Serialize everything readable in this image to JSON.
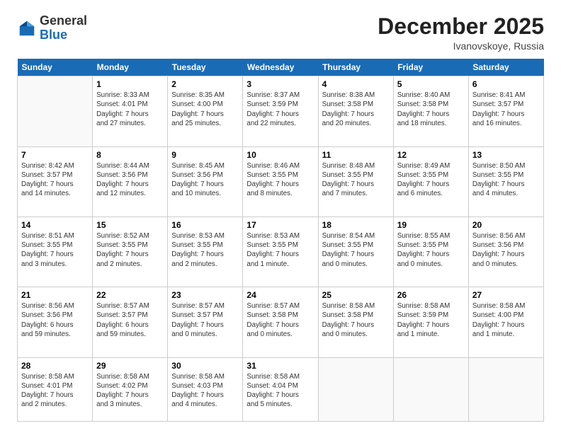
{
  "logo": {
    "general": "General",
    "blue": "Blue"
  },
  "title": "December 2025",
  "location": "Ivanovskoye, Russia",
  "days_header": [
    "Sunday",
    "Monday",
    "Tuesday",
    "Wednesday",
    "Thursday",
    "Friday",
    "Saturday"
  ],
  "weeks": [
    [
      {
        "day": "",
        "info": ""
      },
      {
        "day": "1",
        "info": "Sunrise: 8:33 AM\nSunset: 4:01 PM\nDaylight: 7 hours\nand 27 minutes."
      },
      {
        "day": "2",
        "info": "Sunrise: 8:35 AM\nSunset: 4:00 PM\nDaylight: 7 hours\nand 25 minutes."
      },
      {
        "day": "3",
        "info": "Sunrise: 8:37 AM\nSunset: 3:59 PM\nDaylight: 7 hours\nand 22 minutes."
      },
      {
        "day": "4",
        "info": "Sunrise: 8:38 AM\nSunset: 3:58 PM\nDaylight: 7 hours\nand 20 minutes."
      },
      {
        "day": "5",
        "info": "Sunrise: 8:40 AM\nSunset: 3:58 PM\nDaylight: 7 hours\nand 18 minutes."
      },
      {
        "day": "6",
        "info": "Sunrise: 8:41 AM\nSunset: 3:57 PM\nDaylight: 7 hours\nand 16 minutes."
      }
    ],
    [
      {
        "day": "7",
        "info": "Sunrise: 8:42 AM\nSunset: 3:57 PM\nDaylight: 7 hours\nand 14 minutes."
      },
      {
        "day": "8",
        "info": "Sunrise: 8:44 AM\nSunset: 3:56 PM\nDaylight: 7 hours\nand 12 minutes."
      },
      {
        "day": "9",
        "info": "Sunrise: 8:45 AM\nSunset: 3:56 PM\nDaylight: 7 hours\nand 10 minutes."
      },
      {
        "day": "10",
        "info": "Sunrise: 8:46 AM\nSunset: 3:55 PM\nDaylight: 7 hours\nand 8 minutes."
      },
      {
        "day": "11",
        "info": "Sunrise: 8:48 AM\nSunset: 3:55 PM\nDaylight: 7 hours\nand 7 minutes."
      },
      {
        "day": "12",
        "info": "Sunrise: 8:49 AM\nSunset: 3:55 PM\nDaylight: 7 hours\nand 6 minutes."
      },
      {
        "day": "13",
        "info": "Sunrise: 8:50 AM\nSunset: 3:55 PM\nDaylight: 7 hours\nand 4 minutes."
      }
    ],
    [
      {
        "day": "14",
        "info": "Sunrise: 8:51 AM\nSunset: 3:55 PM\nDaylight: 7 hours\nand 3 minutes."
      },
      {
        "day": "15",
        "info": "Sunrise: 8:52 AM\nSunset: 3:55 PM\nDaylight: 7 hours\nand 2 minutes."
      },
      {
        "day": "16",
        "info": "Sunrise: 8:53 AM\nSunset: 3:55 PM\nDaylight: 7 hours\nand 2 minutes."
      },
      {
        "day": "17",
        "info": "Sunrise: 8:53 AM\nSunset: 3:55 PM\nDaylight: 7 hours\nand 1 minute."
      },
      {
        "day": "18",
        "info": "Sunrise: 8:54 AM\nSunset: 3:55 PM\nDaylight: 7 hours\nand 0 minutes."
      },
      {
        "day": "19",
        "info": "Sunrise: 8:55 AM\nSunset: 3:55 PM\nDaylight: 7 hours\nand 0 minutes."
      },
      {
        "day": "20",
        "info": "Sunrise: 8:56 AM\nSunset: 3:56 PM\nDaylight: 7 hours\nand 0 minutes."
      }
    ],
    [
      {
        "day": "21",
        "info": "Sunrise: 8:56 AM\nSunset: 3:56 PM\nDaylight: 6 hours\nand 59 minutes."
      },
      {
        "day": "22",
        "info": "Sunrise: 8:57 AM\nSunset: 3:57 PM\nDaylight: 6 hours\nand 59 minutes."
      },
      {
        "day": "23",
        "info": "Sunrise: 8:57 AM\nSunset: 3:57 PM\nDaylight: 7 hours\nand 0 minutes."
      },
      {
        "day": "24",
        "info": "Sunrise: 8:57 AM\nSunset: 3:58 PM\nDaylight: 7 hours\nand 0 minutes."
      },
      {
        "day": "25",
        "info": "Sunrise: 8:58 AM\nSunset: 3:58 PM\nDaylight: 7 hours\nand 0 minutes."
      },
      {
        "day": "26",
        "info": "Sunrise: 8:58 AM\nSunset: 3:59 PM\nDaylight: 7 hours\nand 1 minute."
      },
      {
        "day": "27",
        "info": "Sunrise: 8:58 AM\nSunset: 4:00 PM\nDaylight: 7 hours\nand 1 minute."
      }
    ],
    [
      {
        "day": "28",
        "info": "Sunrise: 8:58 AM\nSunset: 4:01 PM\nDaylight: 7 hours\nand 2 minutes."
      },
      {
        "day": "29",
        "info": "Sunrise: 8:58 AM\nSunset: 4:02 PM\nDaylight: 7 hours\nand 3 minutes."
      },
      {
        "day": "30",
        "info": "Sunrise: 8:58 AM\nSunset: 4:03 PM\nDaylight: 7 hours\nand 4 minutes."
      },
      {
        "day": "31",
        "info": "Sunrise: 8:58 AM\nSunset: 4:04 PM\nDaylight: 7 hours\nand 5 minutes."
      },
      {
        "day": "",
        "info": ""
      },
      {
        "day": "",
        "info": ""
      },
      {
        "day": "",
        "info": ""
      }
    ]
  ]
}
